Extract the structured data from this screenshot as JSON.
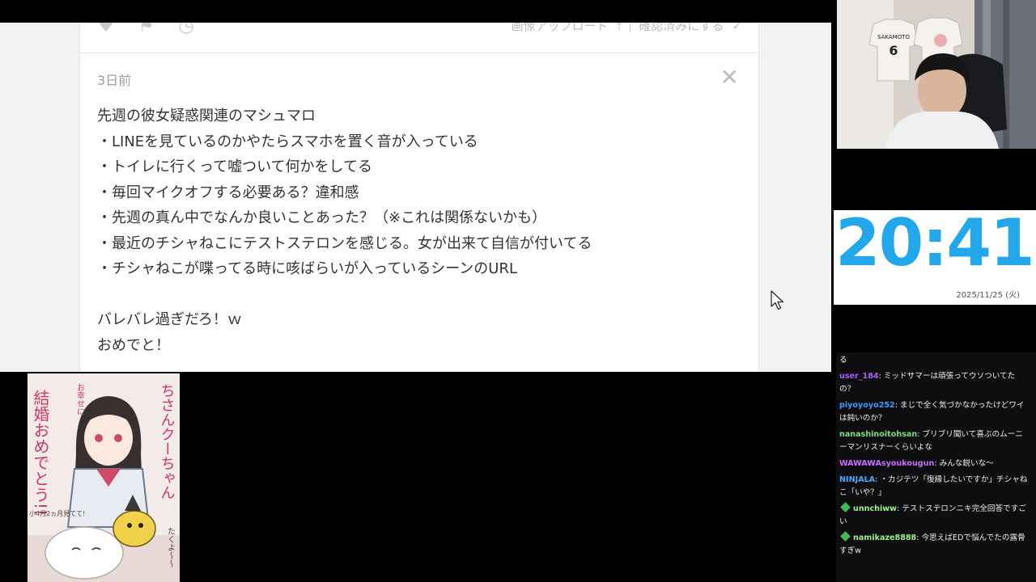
{
  "browser": {
    "previous_card": {
      "actions": [
        "画像アップロード",
        "確認済みにする"
      ]
    },
    "card": {
      "age": "3日前",
      "close_glyph": "✕",
      "lines": [
        "先週の彼女疑惑関連のマシュマロ",
        "・LINEを見ているのかやたらスマホを置く音が入っている",
        "・トイレに行くって嘘ついて何かをしてる",
        "・毎回マイクオフする必要ある？違和感",
        "・先週の真ん中でなんか良いことあった？（※これは関係ないかも）",
        "・最近のチシャねこにテストステロンを感じる。女が出来て自信が付いてる",
        "・チシャねこが喋ってる時に咳ばらいが入っているシーンのURL",
        "",
        "バレバレ過ぎだろ！ｗ",
        "おめでと！"
      ]
    }
  },
  "clock": {
    "time": "20:41",
    "date": "2025/11/25 (火)",
    "color": "#22a8ea"
  },
  "congrats_image": {
    "title": "結婚おめでとう!!",
    "name": "ちさんクーちゃん",
    "note1": "お幸せに",
    "note2": "小4月2ヵ月見てて!",
    "note3": "たくよ～～"
  },
  "webcam": {
    "jersey_name": "SAKAMOTO",
    "jersey_number": "6"
  },
  "chat": {
    "messages": [
      {
        "name": "",
        "color": "#efeff1",
        "badge": false,
        "text": "る"
      },
      {
        "name": "user_184",
        "color": "#b05cff",
        "badge": false,
        "text": "ミッドサマーは頑張ってウソついてたの？"
      },
      {
        "name": "piyoyoyo252",
        "color": "#3b9bff",
        "badge": false,
        "text": "まじで全く気づかなかったけどワイは鈍いのか？"
      },
      {
        "name": "nanashinoitohsan",
        "color": "#7ee07e",
        "badge": false,
        "text": "ブリブリ聞いて喜ぶのムーニーマンリスナーくらいよな"
      },
      {
        "name": "WAWAWAsyoukougun",
        "color": "#c86cff",
        "badge": false,
        "text": "みんな鋭いな～"
      },
      {
        "name": "NINJALA",
        "color": "#4aa8ff",
        "badge": false,
        "text": "・カジテツ「復縁したいですか」チシャねこ「いや？」"
      },
      {
        "name": "unnchiww",
        "color": "#a0f08a",
        "badge": true,
        "text": "テストステロンニキ完全回答ですごい"
      },
      {
        "name": "namikaze8888",
        "color": "#a0f08a",
        "badge": true,
        "text": "今思えばEDで悩んでたの露骨すぎw"
      }
    ]
  }
}
